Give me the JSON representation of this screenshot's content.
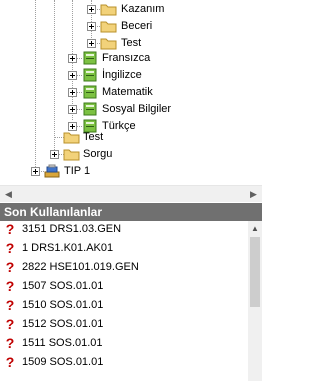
{
  "tree": {
    "items": [
      {
        "label": "Kazanım",
        "icon": "folder-icon"
      },
      {
        "label": "Beceri",
        "icon": "folder-icon"
      },
      {
        "label": "Test",
        "icon": "folder-icon"
      },
      {
        "label": "Fransızca",
        "icon": "book-icon"
      },
      {
        "label": "İngilizce",
        "icon": "book-icon"
      },
      {
        "label": "Matematik",
        "icon": "book-icon"
      },
      {
        "label": "Sosyal Bilgiler",
        "icon": "book-icon"
      },
      {
        "label": "Türkçe",
        "icon": "book-icon"
      },
      {
        "label": "Test",
        "icon": "folder-icon"
      },
      {
        "label": "Sorgu",
        "icon": "folder-icon"
      },
      {
        "label": "TIP 1",
        "icon": "grade-level-icon"
      }
    ]
  },
  "recent": {
    "title": "Son Kullanılanlar",
    "items": [
      "3151 DRS1.03.GEN",
      "1 DRS1.K01.AK01",
      "2822 HSE101.019.GEN",
      "1507 SOS.01.01",
      "1510 SOS.01.01",
      "1512 SOS.01.01",
      "1511 SOS.01.01",
      "1509 SOS.01.01"
    ]
  },
  "colors": {
    "header_bg": "#707070",
    "folder": "#f2d27a",
    "book": "#7cc142",
    "unknown_marker": "#c00000"
  }
}
